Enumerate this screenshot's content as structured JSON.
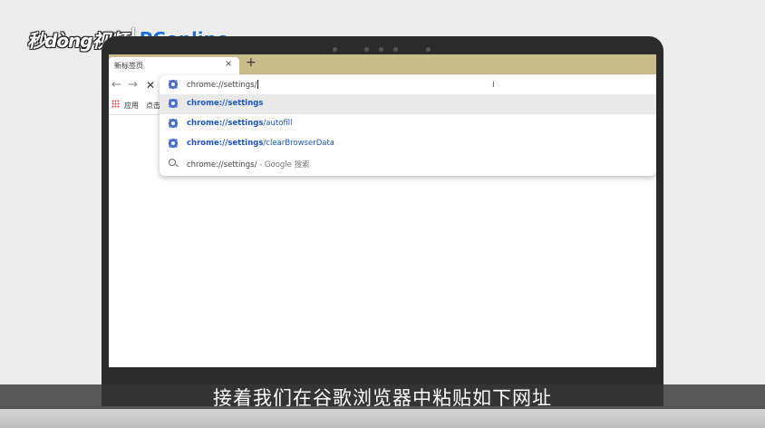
{
  "watermark": {
    "brand": "秒dòng视频",
    "partner": "PConline"
  },
  "browser": {
    "tab_title": "新标签页",
    "tab_close": "×",
    "new_tab": "+",
    "nav_back": "←",
    "nav_forward": "→",
    "nav_stop": "✕",
    "bookmarks": {
      "apps_label": "应用",
      "item_label": "点击"
    }
  },
  "omnibox": {
    "input_value": "chrome://settings/",
    "suggestions": [
      {
        "icon": "gear-icon",
        "bold": "chrome://settings",
        "rest": ""
      },
      {
        "icon": "gear-icon",
        "bold": "chrome://settings",
        "rest": "/autofill"
      },
      {
        "icon": "gear-icon",
        "bold": "chrome://settings",
        "rest": "/clearBrowserData"
      },
      {
        "icon": "search-icon",
        "text": "chrome://settings/",
        "suffix": " - Google 搜索"
      }
    ]
  },
  "subtitle": "接着我们在谷歌浏览器中粘贴如下网址",
  "colors": {
    "tabstrip": "#c9bd8c",
    "link": "#1a56c9",
    "accent_gear": "#4a6fd0"
  }
}
